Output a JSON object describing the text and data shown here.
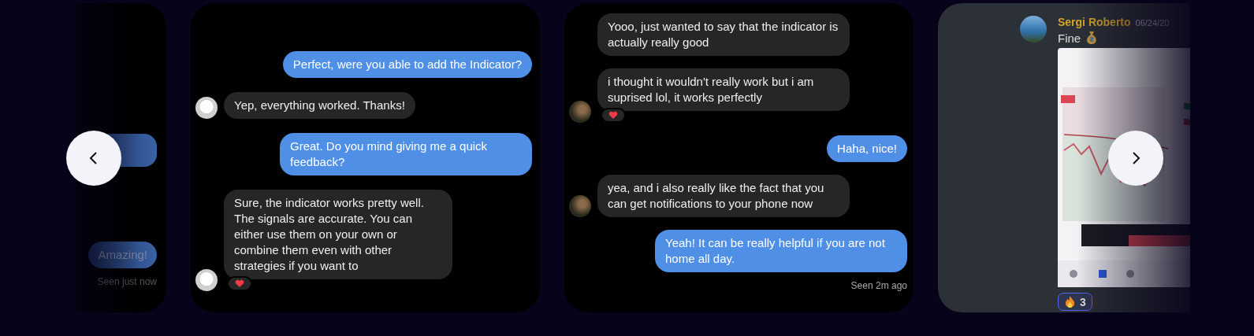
{
  "cards": [
    {
      "kind": "chat",
      "messages": [
        {
          "kind": "sent"
        },
        {
          "kind": "sent",
          "text": "Amazing!"
        }
      ],
      "seen": "Seen just now"
    },
    {
      "kind": "chat",
      "messages": [
        {
          "kind": "sent",
          "text": "Perfect, were you able to add the Indicator?"
        },
        {
          "kind": "received",
          "avatar": true,
          "text": "Yep, everything worked. Thanks!"
        },
        {
          "kind": "sent",
          "text": "Great. Do you mind giving me a quick feedback?"
        },
        {
          "kind": "received",
          "avatar": true,
          "reaction": true,
          "text": "Sure, the indicator works pretty well. The signals are accurate. You can either use them on your own or combine them even with other strategies if you want to"
        }
      ]
    },
    {
      "kind": "chat",
      "messages": [
        {
          "kind": "received",
          "avatar": false,
          "text": "Yooo, just wanted to say that the indicator is actually really good"
        },
        {
          "kind": "received",
          "avatar": true,
          "reaction": true,
          "text": "i thought it wouldn't really work but i am suprised lol, it works perfectly"
        },
        {
          "kind": "sent",
          "text": "Haha, nice!"
        },
        {
          "kind": "received",
          "avatar": true,
          "text": "yea, and i also really like the fact that you can get notifications to your phone now"
        },
        {
          "kind": "sent",
          "text": "Yeah! It can be really helpful if you are not home all day."
        }
      ],
      "seen": "Seen 2m ago"
    },
    {
      "kind": "discord",
      "author": "Sergi Roberto",
      "date": "06/24/20",
      "text": "Fine",
      "reaction_count": "3"
    }
  ]
}
